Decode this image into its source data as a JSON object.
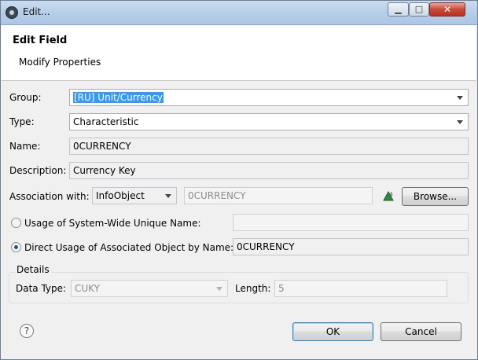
{
  "window": {
    "title": "Edit...",
    "controls": {
      "minimize": "▁",
      "maximize": "□",
      "close": "✕"
    }
  },
  "header": {
    "title": "Edit Field",
    "subtitle": "Modify Properties"
  },
  "form": {
    "group": {
      "label": "Group:",
      "value": "[RU] Unit/Currency"
    },
    "type": {
      "label": "Type:",
      "value": "Characteristic"
    },
    "name": {
      "label": "Name:",
      "value": "0CURRENCY"
    },
    "description": {
      "label": "Description:",
      "value": "Currency Key"
    },
    "association": {
      "label": "Association with:",
      "type_value": "InfoObject",
      "object_value": "0CURRENCY",
      "browse_label": "Browse..."
    },
    "usage_system_wide": {
      "label": "Usage of System-Wide Unique Name:",
      "value": "",
      "selected": false
    },
    "usage_direct": {
      "label": "Direct Usage of Associated Object by Name:",
      "value": "0CURRENCY",
      "selected": true
    }
  },
  "details": {
    "legend": "Details",
    "data_type": {
      "label": "Data Type:",
      "value": "CUKY"
    },
    "length": {
      "label": "Length:",
      "value": "5"
    }
  },
  "footer": {
    "help": "?",
    "ok_label": "OK",
    "cancel_label": "Cancel"
  },
  "colors": {
    "selection": "#3399ff",
    "radio_dot": "#1f4f87",
    "accent_icon": "#2e8b3d"
  },
  "icons": {
    "association_icon": "green-triangle-dollar-icon",
    "help_icon": "help-icon"
  }
}
